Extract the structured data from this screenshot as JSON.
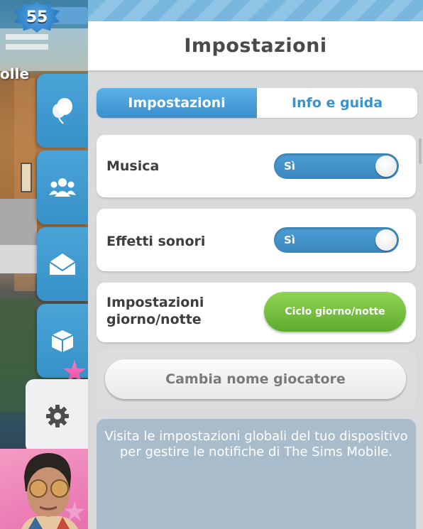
{
  "hud": {
    "level": "55",
    "lot_name_fragment": "olle"
  },
  "sidebar": {
    "tabs": [
      {
        "icon": "balloon-icon"
      },
      {
        "icon": "people-icon"
      },
      {
        "icon": "mail-icon"
      },
      {
        "icon": "box-icon"
      },
      {
        "icon": "gear-icon",
        "active": true
      }
    ]
  },
  "panel": {
    "title": "Impostazioni",
    "tabs": [
      {
        "label": "Impostazioni",
        "active": true
      },
      {
        "label": "Info e guida",
        "active": false
      }
    ],
    "music": {
      "label": "Musica",
      "value": "Sì",
      "on": true
    },
    "sfx": {
      "label": "Effetti sonori",
      "value": "Sì",
      "on": true
    },
    "day_night": {
      "label_line1": "Impostazioni",
      "label_line2": "giorno/notte",
      "button": "Ciclo giorno/notte"
    },
    "rename_button": "Cambia nome giocatore",
    "notification_info": "Visita le impostazioni globali del tuo dispositivo per gestire le notifiche di The Sims Mobile."
  },
  "colors": {
    "accent_blue": "#3a8fcd",
    "toggle_blue": "#4d9fd6",
    "green_button": "#5eac2e",
    "panel_bg": "#d9dadc",
    "info_card": "#a8bccb",
    "notification_star": "#e2479a"
  }
}
